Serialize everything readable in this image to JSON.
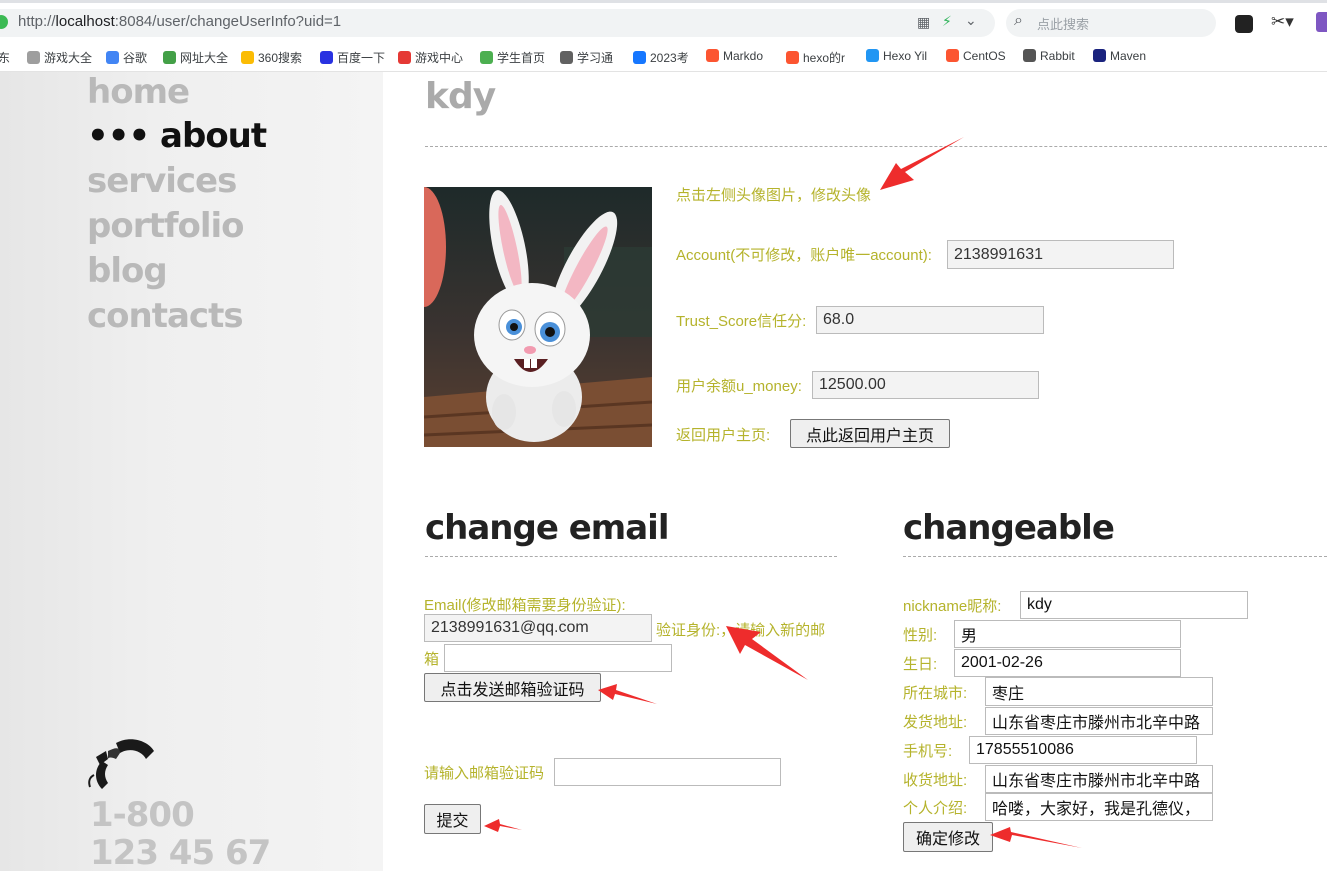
{
  "browser": {
    "url_prefix": "http://",
    "url_host": "localhost",
    "url_rest": ":8084/user/changeUserInfo?uid=1",
    "search_placeholder": "点此搜索",
    "bookmarks": [
      {
        "label": "东",
        "color": "#e53935"
      },
      {
        "label": "游戏大全",
        "color": "#9e9e9e"
      },
      {
        "label": "谷歌",
        "color": "#4285f4"
      },
      {
        "label": "网址大全",
        "color": "#43a047"
      },
      {
        "label": "360搜索",
        "color": "#fbbc04"
      },
      {
        "label": "百度一下",
        "color": "#2932e1"
      },
      {
        "label": "游戏中心",
        "color": "#e53935"
      },
      {
        "label": "学生首页",
        "color": "#4caf50"
      },
      {
        "label": "学习通",
        "color": "#616161"
      },
      {
        "label": "2023考",
        "color": "#1677ff"
      },
      {
        "label": "Markdo",
        "color": "#fc5531"
      },
      {
        "label": "hexo的r",
        "color": "#fc5531"
      },
      {
        "label": "Hexo Yil",
        "color": "#2196f3"
      },
      {
        "label": "CentOS",
        "color": "#fc5531"
      },
      {
        "label": "Rabbit",
        "color": "#555555"
      },
      {
        "label": "Maven",
        "color": "#1a237e"
      }
    ]
  },
  "nav": {
    "items": [
      "home",
      "about",
      "services",
      "portfolio",
      "blog",
      "contacts"
    ],
    "active_prefix": "••• ",
    "phone_line1": "1-800",
    "phone_line2": "123 45 67"
  },
  "profile": {
    "username": "kdy",
    "avatar_hint": "点击左侧头像图片，修改头像",
    "account_label": "Account(不可修改，账户唯一account):",
    "account_value": "2138991631",
    "trust_label": "Trust_Score信任分:",
    "trust_value": "68.0",
    "money_label": "用户余额u_money:",
    "money_value": "12500.00",
    "back_label": "返回用户主页:",
    "back_button": "点此返回用户主页"
  },
  "change_email": {
    "heading": "change email",
    "email_label": "Email(修改邮箱需要身份验证):",
    "email_value": "2138991631@qq.com",
    "verify_label_1": "验证身份:，请输入新的邮",
    "verify_label_2": "箱",
    "new_email_value": "",
    "send_code_button": "点击发送邮箱验证码",
    "code_label": "请输入邮箱验证码",
    "code_value": "",
    "submit_button": "提交"
  },
  "changeable": {
    "heading": "changeable",
    "fields": [
      {
        "label": "nickname昵称:",
        "value": "kdy"
      },
      {
        "label": "性别:",
        "value": "男"
      },
      {
        "label": "生日:",
        "value": "2001-02-26"
      },
      {
        "label": "所在城市:",
        "value": "枣庄"
      },
      {
        "label": "发货地址:",
        "value": "山东省枣庄市滕州市北辛中路"
      },
      {
        "label": "手机号:",
        "value": "17855510086"
      },
      {
        "label": "收货地址:",
        "value": "山东省枣庄市滕州市北辛中路"
      },
      {
        "label": "个人介绍:",
        "value": "哈喽，大家好，我是孔德仪，"
      }
    ],
    "confirm_button": "确定修改"
  },
  "colors": {
    "label_olive": "#b5b32c",
    "annotation_arrow": "#ee2c2c",
    "nav_inactive": "#b9b9b9",
    "nav_active": "#111111"
  }
}
